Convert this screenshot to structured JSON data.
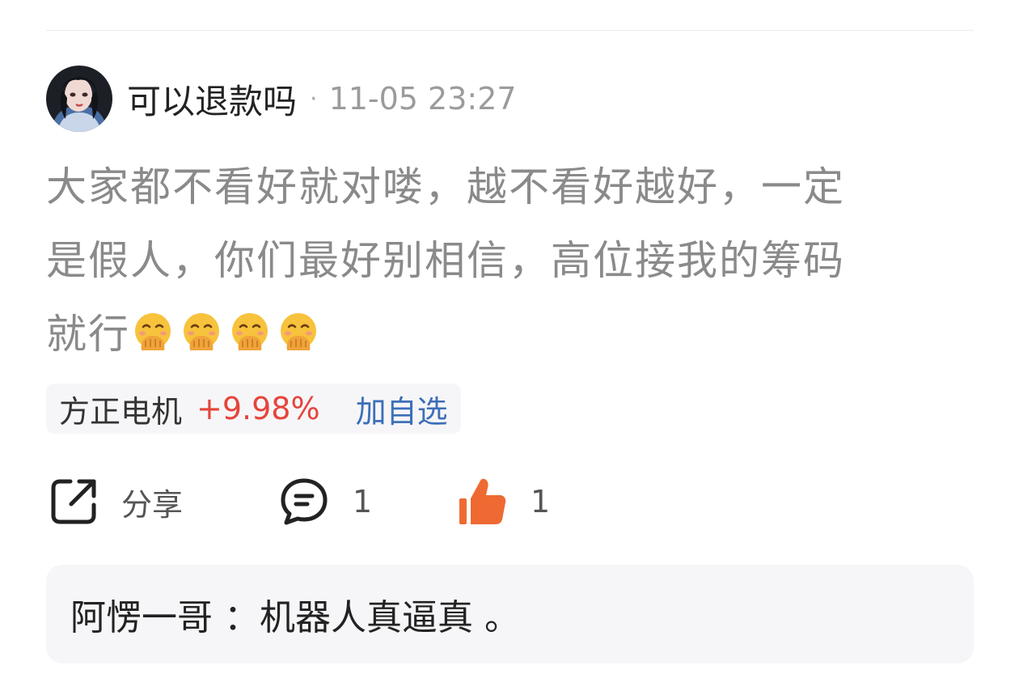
{
  "post": {
    "username": "可以退款吗",
    "separator": "·",
    "timestamp": "11-05 23:27",
    "body_lines": [
      "大家都不看好就对喽，越不看好越好，一定",
      "是假人，你们最好别相信，高位接我的筹码",
      "就行"
    ],
    "emoji_icons": [
      "face-with-hand-over-mouth-icon",
      "face-with-hand-over-mouth-icon",
      "face-with-hand-over-mouth-icon",
      "face-with-hand-over-mouth-icon"
    ]
  },
  "stock": {
    "name": "方正电机",
    "change": "+9.98%",
    "add_label": "加自选",
    "colors": {
      "up": "#e5453b",
      "link": "#3d6fb8"
    }
  },
  "actions": {
    "share_label": "分享",
    "comment_count": "1",
    "like_count": "1",
    "like_color": "#ee6a32"
  },
  "reply": {
    "author": "阿愣一哥",
    "separator": "：",
    "content": "机器人真逼真 。"
  }
}
